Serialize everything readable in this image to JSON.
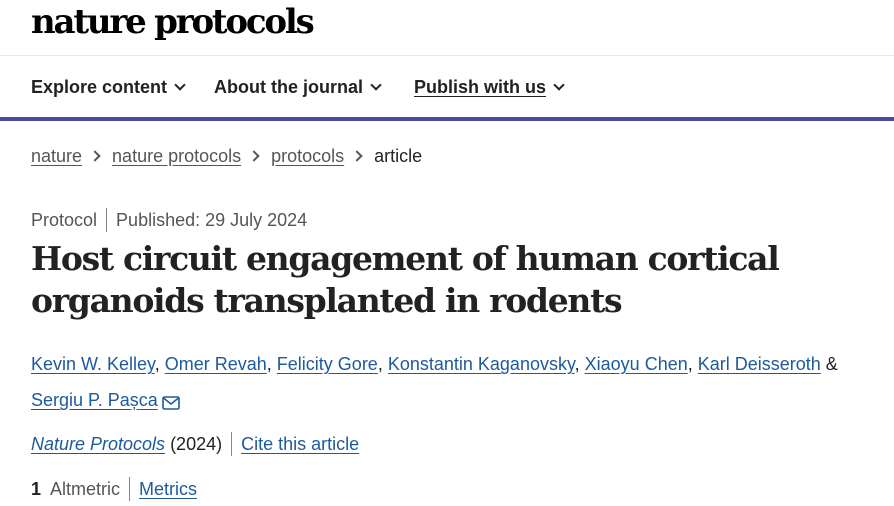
{
  "header": {
    "logo_text": "nature protocols"
  },
  "nav": {
    "items": [
      {
        "label": "Explore content"
      },
      {
        "label": "About the journal"
      },
      {
        "label": "Publish with us"
      }
    ],
    "accent_color": "#4e4aa0"
  },
  "breadcrumb": {
    "items": [
      "nature",
      "nature protocols",
      "protocols"
    ],
    "current": "article"
  },
  "article": {
    "type": "Protocol",
    "published": "Published: 29 July 2024",
    "title": "Host circuit engagement of human cortical organoids transplanted in rodents",
    "authors": [
      "Kevin W. Kelley",
      "Omer Revah",
      "Felicity Gore",
      "Konstantin Kaganovsky",
      "Xiaoyu Chen",
      "Karl Deisseroth",
      "Sergiu P. Pașca"
    ],
    "author_separator": ", ",
    "author_final_separator": " & ",
    "corresponding_icon": "mail-icon",
    "journal": "Nature Protocols",
    "year": "(2024)",
    "cite_label": "Cite this article",
    "altmetric_score": "1",
    "altmetric_label": "Altmetric",
    "metrics_label": "Metrics",
    "link_color": "#1d5a9c"
  }
}
